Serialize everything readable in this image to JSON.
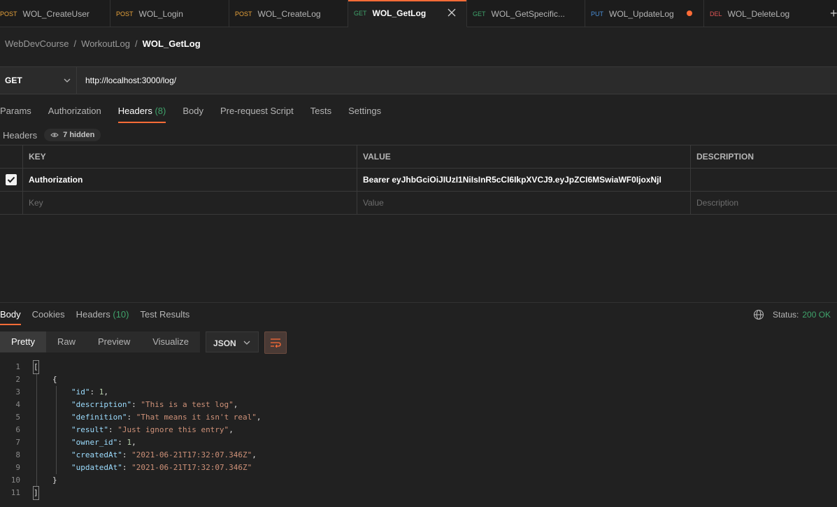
{
  "tabs": [
    {
      "method": "POST",
      "method_color": "#e7a23a",
      "name": "WOL_CreateUser"
    },
    {
      "method": "POST",
      "method_color": "#e7a23a",
      "name": "WOL_Login"
    },
    {
      "method": "POST",
      "method_color": "#e7a23a",
      "name": "WOL_CreateLog"
    },
    {
      "method": "GET",
      "method_color": "#3fa36b",
      "name": "WOL_GetLog"
    },
    {
      "method": "GET",
      "method_color": "#3fa36b",
      "name": "WOL_GetSpecific..."
    },
    {
      "method": "PUT",
      "method_color": "#4a8fd8",
      "name": "WOL_UpdateLog"
    },
    {
      "method": "DEL",
      "method_color": "#e05555",
      "name": "WOL_DeleteLog"
    }
  ],
  "breadcrumb": {
    "items": [
      "WebDevCourse",
      "/",
      "WorkoutLog",
      "/"
    ],
    "current": "WOL_GetLog"
  },
  "request": {
    "method": "GET",
    "url": "http://localhost:3000/log/"
  },
  "request_tabs": [
    {
      "label": "Params"
    },
    {
      "label": "Authorization"
    },
    {
      "label": "Headers",
      "count": "(8)"
    },
    {
      "label": "Body"
    },
    {
      "label": "Pre-request Script"
    },
    {
      "label": "Tests"
    },
    {
      "label": "Settings"
    }
  ],
  "headers_section": {
    "title": "Headers",
    "hidden": "7 hidden"
  },
  "headers_table": {
    "columns": [
      "KEY",
      "VALUE",
      "DESCRIPTION"
    ],
    "rows": [
      {
        "key": "Authorization",
        "value": "Bearer eyJhbGciOiJIUzI1NiIsInR5cCI6IkpXVCJ9.eyJpZCI6MSwiaWF0IjoxNjI",
        "description": ""
      }
    ],
    "placeholders": {
      "key": "Key",
      "value": "Value",
      "description": "Description"
    }
  },
  "response": {
    "tabs": [
      {
        "label": "Body"
      },
      {
        "label": "Cookies"
      },
      {
        "label": "Headers",
        "count": "(10)"
      },
      {
        "label": "Test Results"
      }
    ],
    "status_label": "Status:",
    "status_value": "200 OK",
    "view_modes": [
      "Pretty",
      "Raw",
      "Preview",
      "Visualize"
    ],
    "format": "JSON"
  },
  "code": {
    "line_numbers": [
      "1",
      "2",
      "3",
      "4",
      "5",
      "6",
      "7",
      "8",
      "9",
      "10",
      "11"
    ],
    "l1": "[",
    "l2": "{",
    "l3": {
      "k": "\"id\"",
      "v": "1"
    },
    "l4": {
      "k": "\"description\"",
      "v": "\"This is a test log\""
    },
    "l5": {
      "k": "\"definition\"",
      "v": "\"That means it isn't real\""
    },
    "l6": {
      "k": "\"result\"",
      "v": "\"Just ignore this entry\""
    },
    "l7": {
      "k": "\"owner_id\"",
      "v": "1"
    },
    "l8": {
      "k": "\"createdAt\"",
      "v": "\"2021-06-21T17:32:07.346Z\""
    },
    "l9": {
      "k": "\"updatedAt\"",
      "v": "\"2021-06-21T17:32:07.346Z\""
    },
    "l10": "}",
    "l11": "]"
  }
}
